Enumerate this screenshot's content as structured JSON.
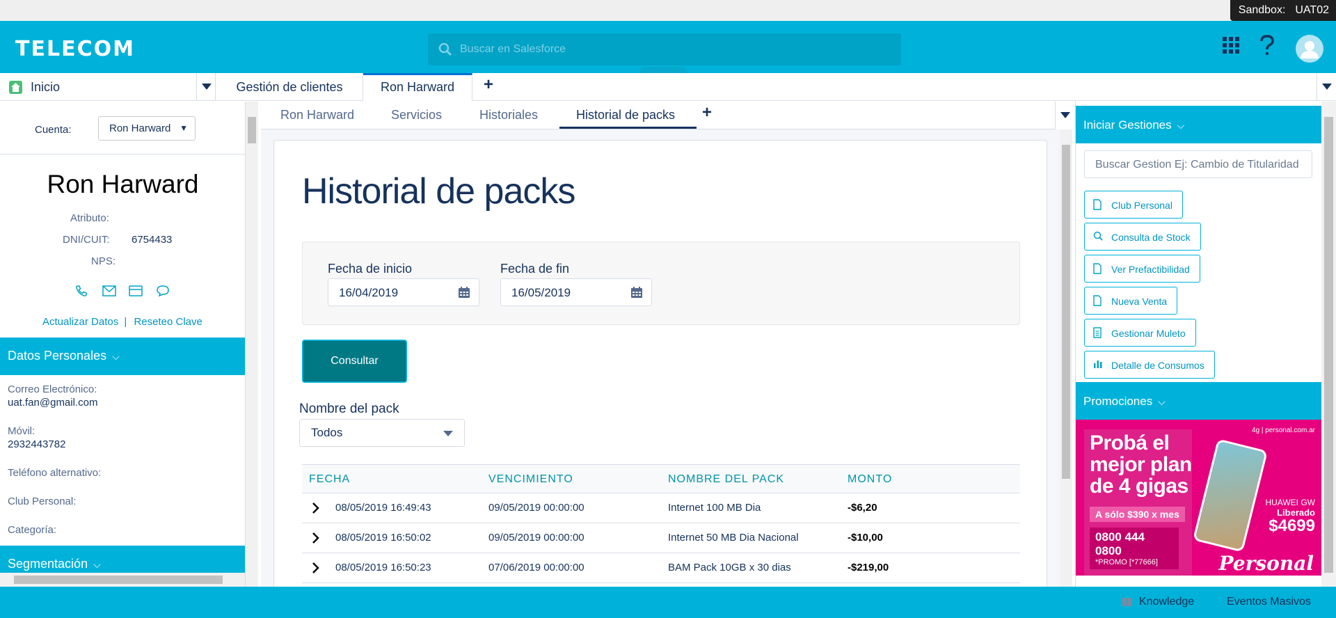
{
  "sandbox": {
    "label": "Sandbox:",
    "name": "UAT02"
  },
  "header": {
    "logo": "TELECOM",
    "search_placeholder": "Buscar en Salesforce"
  },
  "tabbar": {
    "home": "Inicio",
    "tabs": [
      "Gestión de clientes",
      "Ron Harward"
    ],
    "plus": "+"
  },
  "left": {
    "cuenta_label": "Cuenta:",
    "cuenta_value": "Ron Harward",
    "name": "Ron Harward",
    "atributo_label": "Atributo:",
    "dni_label": "DNI/CUIT:",
    "dni_value": "6754433",
    "nps_label": "NPS:",
    "link_actualizar": "Actualizar Datos",
    "link_sep": "|",
    "link_reseteo": "Reseteo Clave",
    "datos_personales": "Datos Personales",
    "fields": {
      "correo_label": "Correo Electrónico:",
      "correo_value": "uat.fan@gmail.com",
      "movil_label": "Móvil:",
      "movil_value": "2932443782",
      "tel_alt_label": "Teléfono alternativo:",
      "club_label": "Club Personal:",
      "categoria_label": "Categoría:"
    },
    "segmentacion": "Segmentación"
  },
  "center": {
    "subtabs": [
      "Ron Harward",
      "Servicios",
      "Historiales",
      "Historial de packs"
    ],
    "plus": "+",
    "title": "Historial de packs",
    "fecha_inicio_label": "Fecha de inicio",
    "fecha_inicio_value": "16/04/2019",
    "fecha_fin_label": "Fecha de fin",
    "fecha_fin_value": "16/05/2019",
    "consultar": "Consultar",
    "nombre_pack_label": "Nombre del pack",
    "nombre_pack_value": "Todos",
    "table": {
      "headers": [
        "FECHA",
        "VENCIMIENTO",
        "NOMBRE DEL PACK",
        "MONTO"
      ],
      "rows": [
        [
          "08/05/2019 16:49:43",
          "09/05/2019 00:00:00",
          "Internet 100 MB Dia",
          "-$6,20"
        ],
        [
          "08/05/2019 16:50:02",
          "09/05/2019 00:00:00",
          "Internet 50 MB Dia Nacional",
          "-$10,00"
        ],
        [
          "08/05/2019 16:50:23",
          "07/06/2019 00:00:00",
          "BAM Pack 10GB x 30 dias",
          "-$219,00"
        ]
      ]
    }
  },
  "right": {
    "iniciar_gestiones": "Iniciar Gestiones",
    "search_placeholder": "Buscar Gestion Ej: Cambio de Titularidad",
    "buttons": [
      "Club Personal",
      "Consulta de Stock",
      "Ver Prefactibilidad",
      "Nueva Venta",
      "Gestionar Muleto",
      "Detalle de Consumos"
    ],
    "promociones": "Promociones",
    "promo": {
      "headline_1": "Probá el",
      "headline_2": "mejor plan",
      "headline_3": "de 4 gigas",
      "price_text": "A sólo $390 x mes",
      "phone_number": "0800 444 0800",
      "promo_code": "*PROMO [*77666]",
      "tag": "4g | personal.com.ar",
      "model": "HUAWEI GW",
      "liberado": "Liberado",
      "price": "$4699",
      "brand": "Personal"
    }
  },
  "footer": {
    "knowledge": "Knowledge",
    "eventos": "Eventos Masivos"
  },
  "colors": {
    "brand": "#00b2d9",
    "navy": "#16325c",
    "consultar": "#007984",
    "promo": "#e6007e"
  }
}
